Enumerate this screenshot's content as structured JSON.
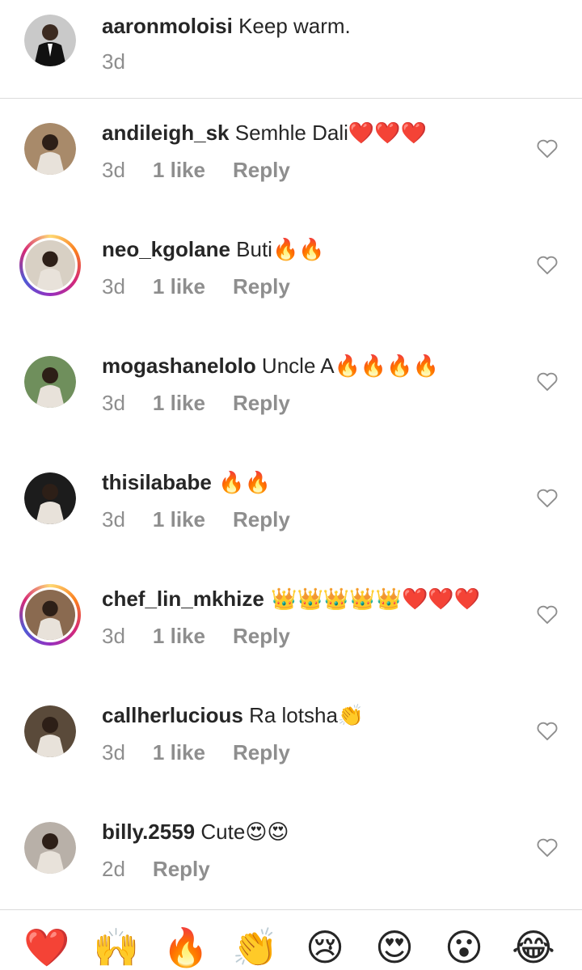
{
  "caption": {
    "username": "aaronmoloisi",
    "text": "Keep warm.",
    "time": "3d"
  },
  "comments": [
    {
      "username": "andileigh_sk",
      "text": "Semhle Dali",
      "emoji": "❤️❤️❤️",
      "time": "3d",
      "likes": "1 like",
      "reply": "Reply",
      "story_ring": false
    },
    {
      "username": "neo_kgolane",
      "text": "Buti",
      "emoji": "🔥🔥",
      "time": "3d",
      "likes": "1 like",
      "reply": "Reply",
      "story_ring": true
    },
    {
      "username": "mogashanelolo",
      "text": "Uncle A",
      "emoji": "🔥🔥🔥🔥",
      "time": "3d",
      "likes": "1 like",
      "reply": "Reply",
      "story_ring": false
    },
    {
      "username": "thisilababe",
      "text": "",
      "emoji": "🔥🔥",
      "time": "3d",
      "likes": "1 like",
      "reply": "Reply",
      "story_ring": false
    },
    {
      "username": "chef_lin_mkhize",
      "text": "",
      "emoji": "👑👑👑👑👑❤️❤️❤️",
      "time": "3d",
      "likes": "1 like",
      "reply": "Reply",
      "story_ring": true
    },
    {
      "username": "callherlucious",
      "text": "Ra lotsha",
      "emoji": "👏",
      "time": "3d",
      "likes": "1 like",
      "reply": "Reply",
      "story_ring": false
    },
    {
      "username": "billy.2559",
      "text": "Cute",
      "emoji": "😍😍",
      "time": "2d",
      "likes": "",
      "reply": "Reply",
      "story_ring": false
    }
  ],
  "reactions": [
    "❤️",
    "🙌",
    "🔥",
    "👏",
    "😢",
    "😍",
    "😮",
    "😂"
  ],
  "colors": {
    "text": "#262626",
    "meta": "#8e8e8e",
    "divider": "#dbdbdb"
  }
}
